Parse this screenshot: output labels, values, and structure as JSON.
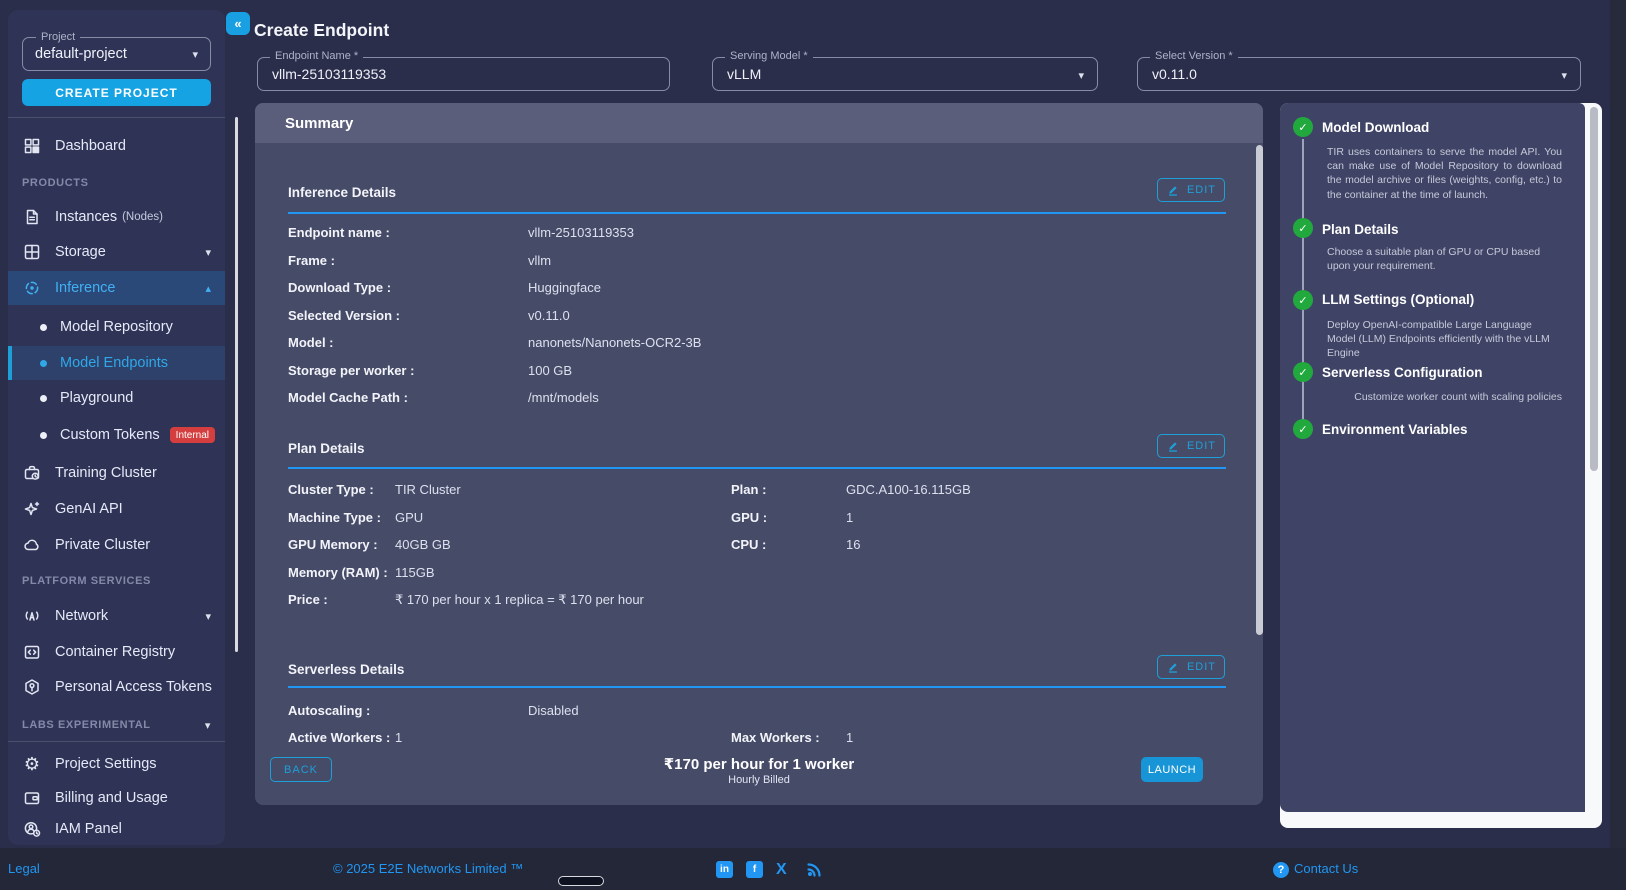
{
  "colors": {
    "accent_blue": "#2196f3",
    "edit_blue": "#1e9fd8",
    "create_button_blue": "#16a3e3",
    "green_check": "#22a93e",
    "badge_red": "#d53e3e"
  },
  "icons": {
    "collapse": "«",
    "caret_down": "▾",
    "caret_up": "▴",
    "check": "✓",
    "gear": "⚙",
    "question": "?",
    "linkedin_glyph": "in",
    "facebook_glyph": "f",
    "x_glyph": "X"
  },
  "project_panel": {
    "label": "Project",
    "selected_project": "default-project",
    "create_project_label": "CREATE PROJECT"
  },
  "sidebar": {
    "items": [
      {
        "label": "Dashboard"
      },
      {
        "label": "PRODUCTS"
      },
      {
        "label": "Instances",
        "suffix": "(Nodes)"
      },
      {
        "label": "Storage"
      },
      {
        "label": "Inference"
      },
      {
        "label": "Model Repository"
      },
      {
        "label": "Model Endpoints"
      },
      {
        "label": "Playground"
      },
      {
        "label": "Custom Tokens",
        "badge": "Internal"
      },
      {
        "label": "Training Cluster"
      },
      {
        "label": "GenAI API"
      },
      {
        "label": "Private Cluster"
      },
      {
        "label": "PLATFORM SERVICES"
      },
      {
        "label": "Network"
      },
      {
        "label": "Container Registry"
      },
      {
        "label": "Personal Access Tokens"
      },
      {
        "label": "LABS EXPERIMENTAL"
      },
      {
        "label": "Project Settings"
      },
      {
        "label": "Billing and Usage"
      },
      {
        "label": "IAM Panel"
      }
    ]
  },
  "header": {
    "title": "Create Endpoint"
  },
  "form": {
    "endpoint_name": {
      "label": "Endpoint Name *",
      "value": "vllm-25103119353"
    },
    "serving_model": {
      "label": "Serving Model *",
      "value": "vLLM"
    },
    "select_version": {
      "label": "Select Version *",
      "value": "v0.11.0"
    }
  },
  "summary": {
    "title": "Summary",
    "edit_label": "EDIT",
    "inference": {
      "title": "Inference Details",
      "rows": [
        {
          "label": "Endpoint name :",
          "value": "vllm-25103119353"
        },
        {
          "label": "Frame :",
          "value": "vllm"
        },
        {
          "label": "Download Type :",
          "value": "Huggingface"
        },
        {
          "label": "Selected Version :",
          "value": "v0.11.0"
        },
        {
          "label": "Model :",
          "value": "nanonets/Nanonets-OCR2-3B"
        },
        {
          "label": "Storage per worker :",
          "value": "100 GB"
        },
        {
          "label": "Model Cache Path :",
          "value": "/mnt/models"
        }
      ]
    },
    "plan": {
      "title": "Plan Details",
      "left_rows": [
        {
          "label": "Cluster Type :",
          "value": "TIR Cluster"
        },
        {
          "label": "Machine Type :",
          "value": "GPU"
        },
        {
          "label": "GPU Memory :",
          "value": "40GB GB"
        },
        {
          "label": "Memory (RAM) :",
          "value": "115GB"
        },
        {
          "label": "Price :",
          "value": "₹ 170 per hour x 1 replica = ₹ 170 per hour"
        }
      ],
      "right_rows": [
        {
          "label": "Plan :",
          "value": "GDC.A100-16.115GB"
        },
        {
          "label": "GPU :",
          "value": "1"
        },
        {
          "label": "CPU :",
          "value": "16"
        }
      ]
    },
    "serverless": {
      "title": "Serverless Details",
      "autoscaling_label": "Autoscaling :",
      "autoscaling_value": "Disabled",
      "active_workers_label": "Active Workers :",
      "active_workers_value": "1",
      "max_workers_label": "Max Workers :",
      "max_workers_value": "1"
    },
    "footer": {
      "back_label": "BACK",
      "price": "₹170 per hour for 1 worker",
      "billing_note": "Hourly Billed",
      "launch_label": "LAUNCH"
    }
  },
  "steps": [
    {
      "title": "Model Download",
      "desc": "TIR uses containers to serve the model API. You can make use of Model Repository to download the model archive or files (weights, config, etc.) to the container at the time of launch."
    },
    {
      "title": "Plan Details",
      "desc": "Choose a suitable plan of GPU or CPU based upon your requirement."
    },
    {
      "title": "LLM Settings (Optional)",
      "desc": "Deploy OpenAI-compatible Large Language Model (LLM) Endpoints efficiently with the vLLM Engine"
    },
    {
      "title": "Serverless Configuration",
      "desc": "Customize worker count with scaling policies"
    },
    {
      "title": "Environment Variables",
      "desc": ""
    }
  ],
  "page_footer": {
    "legal": "Legal",
    "copyright": "© 2025 E2E Networks Limited ™",
    "contact": "Contact Us",
    "social_icons": [
      "linkedin-icon",
      "facebook-icon",
      "x-icon",
      "rss-icon"
    ]
  }
}
